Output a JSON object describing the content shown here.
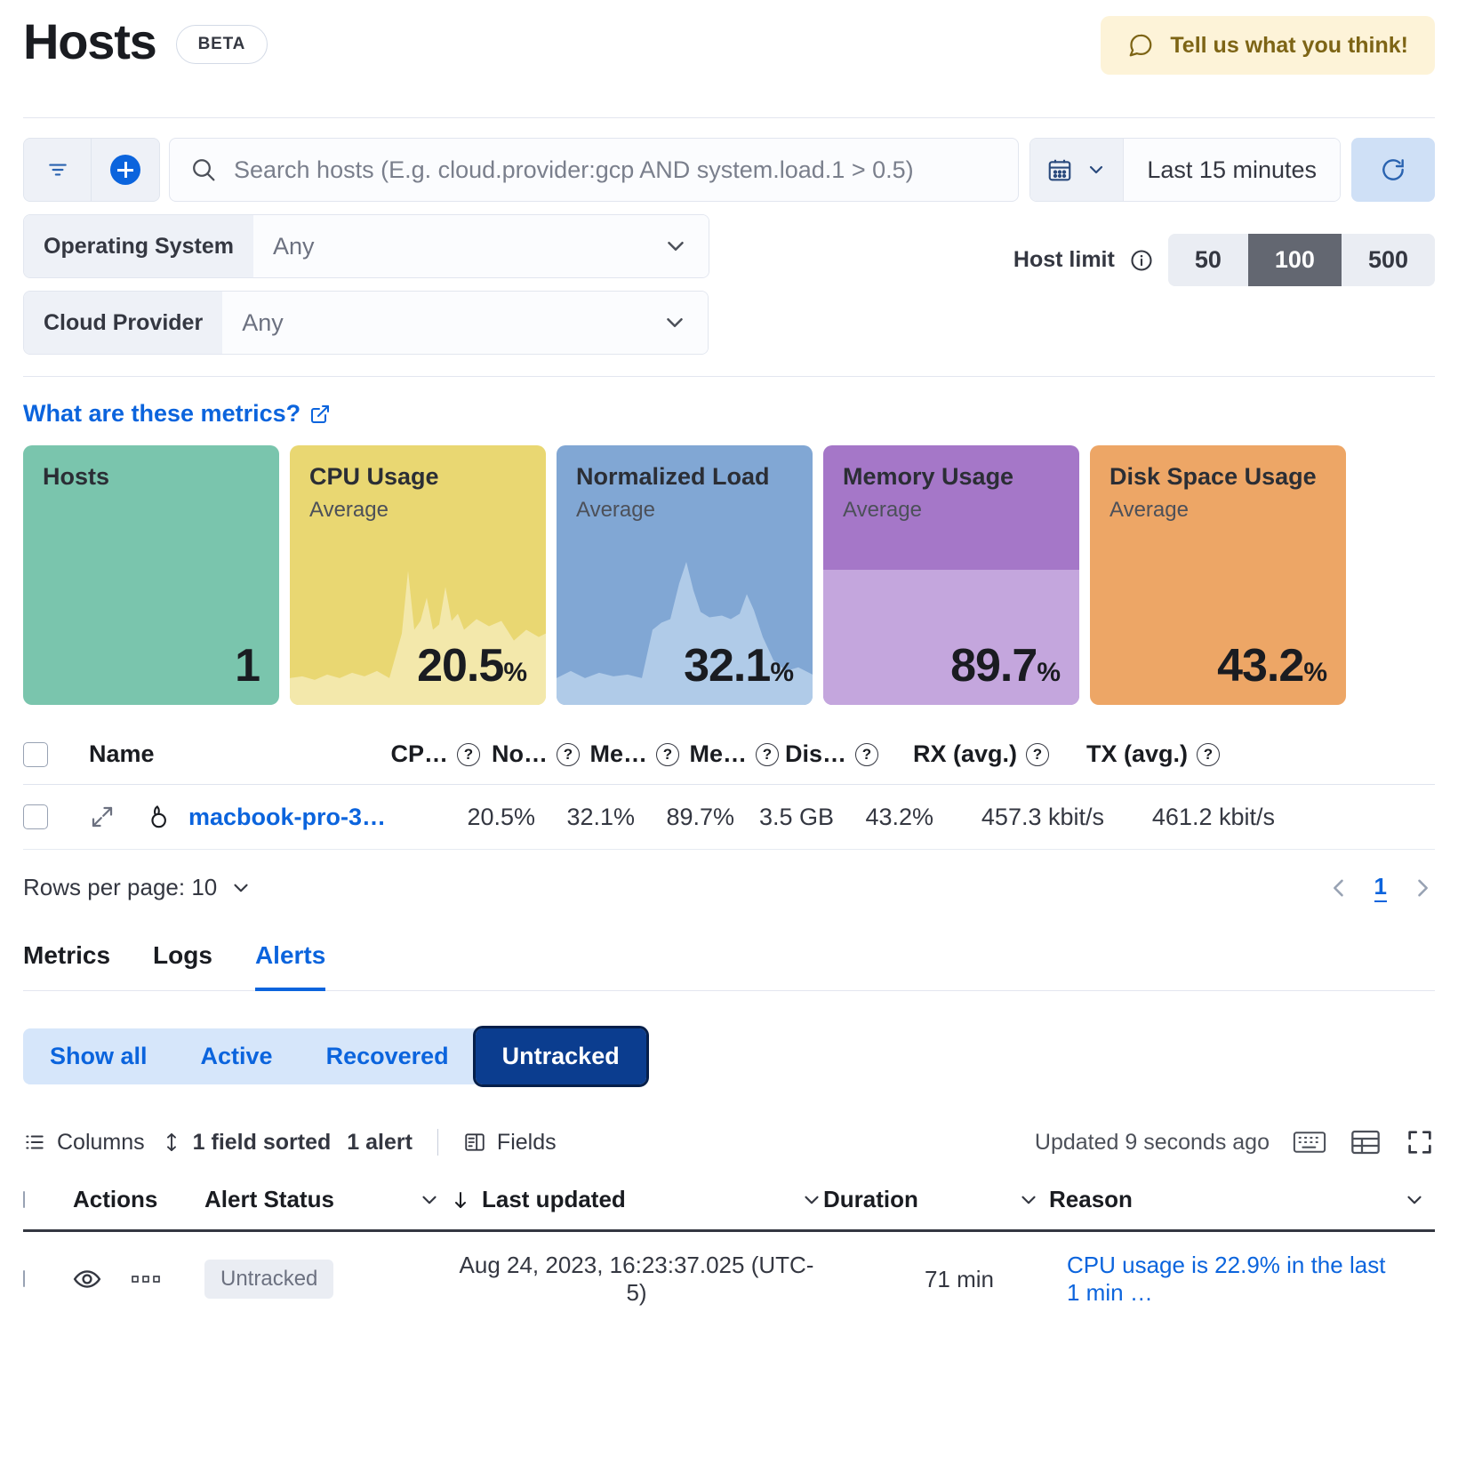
{
  "header": {
    "title": "Hosts",
    "beta_badge": "BETA",
    "feedback_label": "Tell us what you think!",
    "feedback_bg": "#fdf3d8",
    "feedback_fg": "#7d6415"
  },
  "toolbar": {
    "filter_icon": "filter-icon",
    "add_icon": "add-filter-icon",
    "search_placeholder": "Search hosts (E.g. cloud.provider:gcp AND system.load.1 > 0.5)",
    "search_value": "",
    "search_icon": "search-icon",
    "date_icon": "calendar-icon",
    "date_range": "Last 15 minutes",
    "refresh_icon": "refresh-icon"
  },
  "filters": [
    {
      "label": "Operating System",
      "value": "Any"
    },
    {
      "label": "Cloud Provider",
      "value": "Any"
    }
  ],
  "host_limit": {
    "label": "Host limit",
    "info_icon": "info-icon",
    "options": [
      "50",
      "100",
      "500"
    ],
    "selected": "100"
  },
  "metrics": {
    "link_label": "What are these metrics?",
    "link_icon": "external-link-icon",
    "cards": [
      {
        "title": "Hosts",
        "subtitle": "",
        "value": "1",
        "unit": "",
        "bg": "#7ac5ad",
        "fill": "#7ac5ad",
        "fill_pct": 0,
        "type": "plain"
      },
      {
        "title": "CPU Usage",
        "subtitle": "Average",
        "value": "20.5",
        "unit": "%",
        "bg": "#e9d772",
        "fill": "#f2e6a5",
        "fill_pct": 0,
        "type": "spark"
      },
      {
        "title": "Normalized Load",
        "subtitle": "Average",
        "value": "32.1",
        "unit": "%",
        "bg": "#81a7d4",
        "fill": "#aac6e5",
        "fill_pct": 0,
        "type": "spark"
      },
      {
        "title": "Memory Usage",
        "subtitle": "Average",
        "value": "89.7",
        "unit": "%",
        "bg": "#a577c8",
        "fill": "#c4a6dd",
        "fill_pct": 52,
        "type": "level"
      },
      {
        "title": "Disk Space Usage",
        "subtitle": "Average",
        "value": "43.2",
        "unit": "%",
        "bg": "#eda666",
        "fill": "#eda666",
        "fill_pct": 0,
        "type": "plain"
      }
    ]
  },
  "hosts_table": {
    "columns": [
      {
        "key": "name",
        "label": "Name",
        "help": false
      },
      {
        "key": "cpu",
        "label": "CP…",
        "help": true
      },
      {
        "key": "load",
        "label": "No…",
        "help": true
      },
      {
        "key": "mem",
        "label": "Me…",
        "help": true
      },
      {
        "key": "mem2",
        "label": "Me…",
        "help": true
      },
      {
        "key": "disk",
        "label": "Dis…",
        "help": true
      },
      {
        "key": "rx",
        "label": "RX (avg.)",
        "help": true
      },
      {
        "key": "tx",
        "label": "TX (avg.)",
        "help": true
      }
    ],
    "rows": [
      {
        "os_icon": "macos-icon",
        "expand_icon": "expand-icon",
        "name": "macbook-pro-3…",
        "cpu": "20.5%",
        "load": "32.1%",
        "mem": "89.7%",
        "mem2": "3.5 GB",
        "disk": "43.2%",
        "rx": "457.3 kbit/s",
        "tx": "461.2 kbit/s"
      }
    ]
  },
  "pagination": {
    "rows_per_page_label": "Rows per page: 10",
    "prev_icon": "chevron-left-icon",
    "next_icon": "chevron-right-icon",
    "current_page": "1"
  },
  "tabs": [
    {
      "label": "Metrics",
      "active": false
    },
    {
      "label": "Logs",
      "active": false
    },
    {
      "label": "Alerts",
      "active": true
    }
  ],
  "alert_status_filters": [
    {
      "label": "Show all",
      "selected": false
    },
    {
      "label": "Active",
      "selected": false
    },
    {
      "label": "Recovered",
      "selected": false
    },
    {
      "label": "Untracked",
      "selected": true
    }
  ],
  "alerts_toolbar": {
    "columns_label": "Columns",
    "columns_icon": "columns-icon",
    "sort_label": "1 field sorted",
    "sort_icon": "sort-icon",
    "alert_count": "1 alert",
    "fields_label": "Fields",
    "fields_icon": "fields-icon",
    "updated_label": "Updated 9 seconds ago",
    "keyboard_icon": "keyboard-icon",
    "density-icon": "density-icon",
    "fullscreen_icon": "fullscreen-icon"
  },
  "alerts_table": {
    "columns": [
      {
        "label": "Actions",
        "sortable": false
      },
      {
        "label": "Alert Status",
        "sortable": true
      },
      {
        "label": "Last updated",
        "sortable": true,
        "sort_dir": "desc"
      },
      {
        "label": "Duration",
        "sortable": true
      },
      {
        "label": "Reason",
        "sortable": true
      }
    ],
    "rows": [
      {
        "view_icon": "eye-icon",
        "more_icon": "more-actions-icon",
        "status": "Untracked",
        "last_updated": "Aug 24, 2023, 16:23:37.025 (UTC-5)",
        "duration": "71 min",
        "reason": "CPU usage is 22.9% in the last 1 min …"
      }
    ]
  }
}
